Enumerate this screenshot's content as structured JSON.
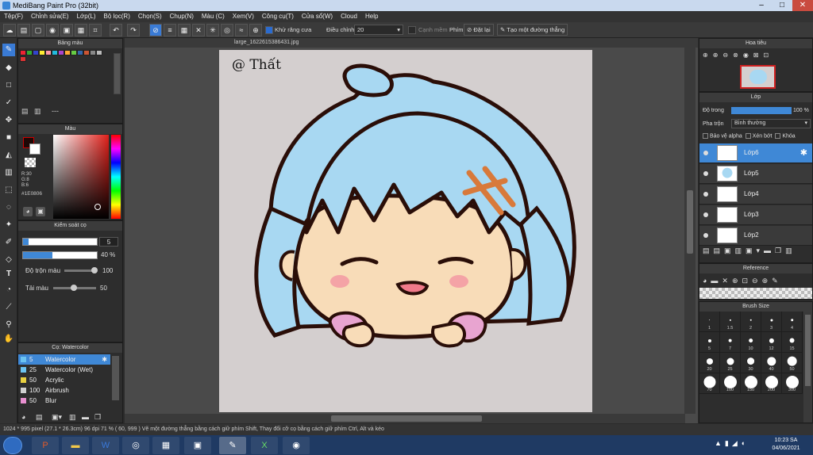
{
  "window": {
    "title": "MediBang Paint Pro (32bit)",
    "min": "–",
    "max": "□",
    "close": "✕"
  },
  "menu": [
    "Tệp(F)",
    "Chỉnh sửa(E)",
    "Lớp(L)",
    "Bộ lọc(R)",
    "Chọn(S)",
    "Chụp(N)",
    "Màu (C)",
    "Xem(V)",
    "Công cụ(T)",
    "Cửa sổ(W)",
    "Cloud",
    "Help"
  ],
  "toolbar": {
    "antialias_label": "Khử răng cưa",
    "correction_label": "Điều chỉnh",
    "correction_value": "20",
    "softedge_label": "Cạnh mềm",
    "key_label": "Phím",
    "reset_label": "Đặt lại",
    "straight_label": "Tạo một đường thẳng"
  },
  "panels": {
    "swatches": "Bảng màu",
    "color": "Màu",
    "brush_control": "Kiểm soát cọ",
    "brush": "Cọ: Watercolor",
    "navigator": "Hoa tiêu",
    "layer": "Lớp",
    "reference": "Reference",
    "brush_size": "Brush Size"
  },
  "color": {
    "rgb": [
      "R:30",
      "G:8",
      "B:6"
    ],
    "hex": "#1E0806",
    "primary": "#1e0806"
  },
  "brush_control": {
    "size": "5",
    "opacity": "40 %",
    "blend_label": "Độ trộn màu",
    "blend_value": "100",
    "pigment_label": "Tải màu",
    "pigment_value": "50"
  },
  "brushes": [
    {
      "size": "5",
      "name": "Watercolor",
      "color": "#6cc3f0"
    },
    {
      "size": "25",
      "name": "Watercolor (Wet)",
      "color": "#6cc3f0"
    },
    {
      "size": "50",
      "name": "Acrylic",
      "color": "#e8d040"
    },
    {
      "size": "100",
      "name": "Airbrush",
      "color": "#d0d0d0"
    },
    {
      "size": "50",
      "name": "Blur",
      "color": "#e890d0"
    }
  ],
  "document": {
    "tab": "large_1622615386431.jpg",
    "signature_text": "@ Thất"
  },
  "layers": {
    "opacity_label": "Độ trong",
    "opacity_value": "100 %",
    "blend_label": "Pha trộn",
    "blend_value": "Bình thường",
    "protect_alpha": "Bảo vệ alpha",
    "clipping": "Xén bớt",
    "lock": "Khóa",
    "items": [
      {
        "name": "Lớp6"
      },
      {
        "name": "Lớp5"
      },
      {
        "name": "Lớp4"
      },
      {
        "name": "Lớp3"
      },
      {
        "name": "Lớp2"
      }
    ]
  },
  "brush_sizes": [
    "1",
    "1.5",
    "2",
    "3",
    "4",
    "5",
    "7",
    "10",
    "12",
    "15",
    "20",
    "25",
    "30",
    "40",
    "50",
    "70",
    "100",
    "150",
    "200",
    "300"
  ],
  "status": "1024 * 995 pixel  (27.1 * 26.3cm)  96 dpi  71 %  ( 60, 999 )  Vẽ một đường thẳng bằng cách giữ phím Shift, Thay đổi cỡ cọ bằng cách giữ phím Ctrl, Alt và kéo",
  "clock": {
    "time": "10:23 SA",
    "date": "04/06/2021"
  }
}
